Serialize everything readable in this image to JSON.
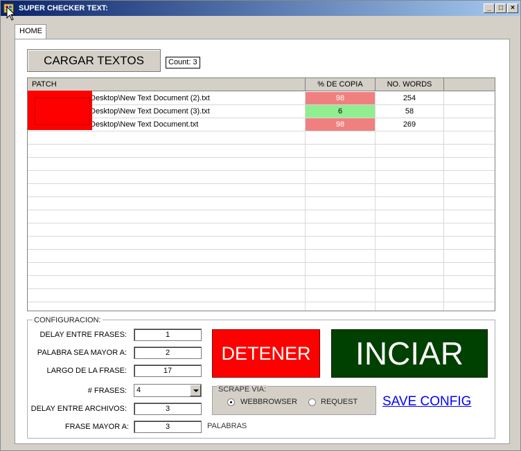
{
  "window": {
    "title": "SUPER CHECKER TEXT:"
  },
  "tabs": [
    {
      "label": "HOME"
    }
  ],
  "toolbar": {
    "load_button_label": "CARGAR TEXTOS",
    "count_label": "Count: 3"
  },
  "grid": {
    "columns": [
      "PATCH",
      "% DE COPIA",
      "NO. WORDS"
    ],
    "rows": [
      {
        "path": "Desktop\\New Text Document (2).txt",
        "percent": "98",
        "words": "254",
        "status_color": "#f08080"
      },
      {
        "path": "Desktop\\New Text Document (3).txt",
        "percent": "6",
        "words": "58",
        "status_color": "#90ee90"
      },
      {
        "path": "Desktop\\New Text Document.txt",
        "percent": "98",
        "words": "269",
        "status_color": "#f08080"
      }
    ]
  },
  "config": {
    "legend": "CONFIGURACION:",
    "fields": [
      {
        "label": "DELAY ENTRE FRASES:",
        "value": "1"
      },
      {
        "label": "PALABRA SEA MAYOR A:",
        "value": "2"
      },
      {
        "label": "LARGO DE LA FRASE:",
        "value": "17"
      },
      {
        "label": "# FRASES:",
        "value": "4"
      },
      {
        "label": "DELAY ENTRE ARCHIVOS:",
        "value": "3"
      },
      {
        "label": "FRASE MAYOR A:",
        "value": "3"
      }
    ],
    "palabras_label": "PALABRAS",
    "stop_button_label": "DETENER",
    "start_button_label": "INCIAR",
    "scrape": {
      "legend": "SCRAPE VIA:",
      "options": [
        "WEBBROWSER",
        "REQUEST"
      ],
      "selected": "WEBBROWSER"
    },
    "save_link_label": "SAVE CONFIG"
  },
  "colors": {
    "stop": "#ff0000",
    "start": "#004000",
    "high_copy": "#f08080",
    "low_copy": "#90ee90"
  }
}
